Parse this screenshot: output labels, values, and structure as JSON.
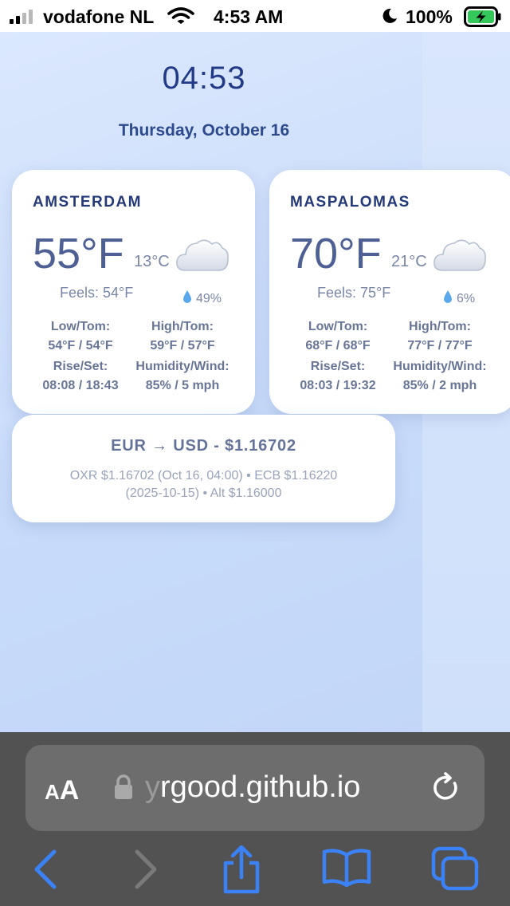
{
  "status_bar": {
    "carrier": "vodafone NL",
    "time": "4:53 AM",
    "battery": "100%",
    "icons": [
      "signal-icon",
      "wifi-icon",
      "moon-icon",
      "battery-charging-icon"
    ]
  },
  "page": {
    "clock": "04:53",
    "date": "Thursday, October 16",
    "cities": [
      {
        "name": "AMSTERDAM",
        "temp_f": "55°F",
        "temp_c": "13°C",
        "icon": "cloud-icon",
        "feels": "Feels: 54°F",
        "rain": "49%",
        "low_label": "Low/Tom:",
        "low_value": "54°F / 54°F",
        "high_label": "High/Tom:",
        "high_value": "59°F / 57°F",
        "rise_label": "Rise/Set:",
        "rise_value": "08:08 / 18:43",
        "hum_label": "Humidity/Wind:",
        "hum_value": "85% / 5 mph"
      },
      {
        "name": "MASPALOMAS",
        "temp_f": "70°F",
        "temp_c": "21°C",
        "icon": "cloud-icon",
        "feels": "Feels: 75°F",
        "rain": "6%",
        "low_label": "Low/Tom:",
        "low_value": "68°F / 68°F",
        "high_label": "High/Tom:",
        "high_value": "77°F / 77°F",
        "rise_label": "Rise/Set:",
        "rise_value": "08:03 / 19:32",
        "hum_label": "Humidity/Wind:",
        "hum_value": "85% / 2 mph"
      }
    ],
    "fx": {
      "title": "EUR → USD - $1.16702",
      "detail_line1": "OXR $1.16702 (Oct 16, 04:00) • ECB $1.16220",
      "detail_line2": "(2025-10-15) • Alt $1.16000"
    }
  },
  "browser": {
    "aa_small": "A",
    "aa_big": "A",
    "url_faded": "y",
    "url": "rgood.github.io",
    "buttons": [
      "back-icon",
      "forward-icon",
      "share-icon",
      "bookmarks-icon",
      "tabs-icon"
    ]
  },
  "colors": {
    "accent": "#3b82f6",
    "page_bg": "#cfdffb",
    "card_bg": "#ffffff",
    "title_text": "#243a78",
    "browser_bar": "#525252"
  }
}
